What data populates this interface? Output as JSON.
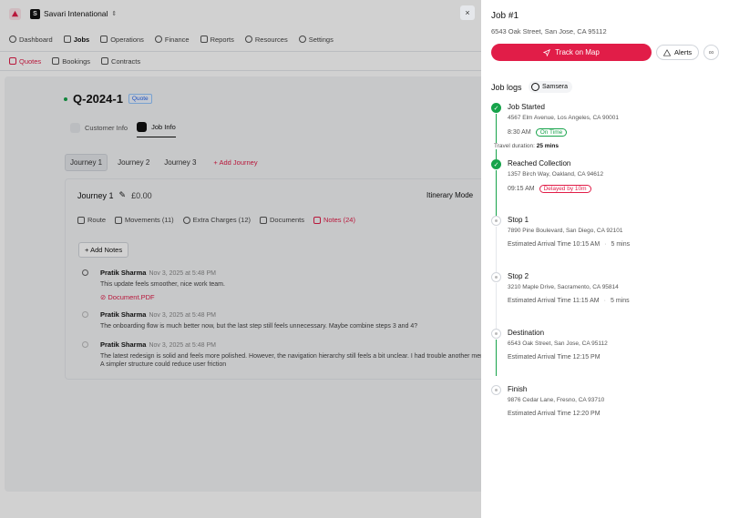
{
  "topbar": {
    "org_initial": "S",
    "org_name": "Savari Intenational"
  },
  "mainnav": [
    {
      "label": "Dashboard",
      "active": false
    },
    {
      "label": "Jobs",
      "active": true
    },
    {
      "label": "Operations",
      "active": false
    },
    {
      "label": "Finance",
      "active": false
    },
    {
      "label": "Reports",
      "active": false
    },
    {
      "label": "Resources",
      "active": false
    },
    {
      "label": "Settings",
      "active": false
    }
  ],
  "subnav": [
    {
      "label": "Quotes",
      "active": true
    },
    {
      "label": "Bookings",
      "active": false
    },
    {
      "label": "Contracts",
      "active": false
    }
  ],
  "quote": {
    "id": "Q-2024-1",
    "badge": "Quote"
  },
  "info_tabs": [
    {
      "label": "Customer Info"
    },
    {
      "label": "Job Info"
    }
  ],
  "journeys": {
    "tabs": [
      "Journey 1",
      "Journey 2",
      "Journey 3"
    ],
    "add_label": "Add Journey"
  },
  "card": {
    "title": "Journey 1",
    "amount": "£0.00",
    "itinerary_label": "Itinerary Mode",
    "tabs": [
      "Route",
      "Movements (11)",
      "Extra Charges (12)",
      "Documents",
      "Notes (24)"
    ],
    "add_notes_label": "Add Notes"
  },
  "notes": [
    {
      "author": "Pratik Sharma",
      "time": "Nov 3, 2025 at 5:48 PM",
      "text": "This update feels smoother, nice work team.",
      "attachment": "Document.PDF"
    },
    {
      "author": "Pratik Sharma",
      "time": "Nov 3, 2025 at 5:48 PM",
      "text": "The onboarding flow is much better now, but the last step still feels unnecessary. Maybe combine steps 3 and 4?"
    },
    {
      "author": "Pratik Sharma",
      "time": "Nov 3, 2025 at 5:48 PM",
      "text": "The latest redesign is solid and feels more polished. However, the navigation hierarchy still feels a bit unclear. I had trouble another menu. A simpler structure could reduce user friction"
    }
  ],
  "panel": {
    "close_glyph": "×",
    "job_title": "Job #1",
    "job_address": "6543 Oak Street, San Jose, CA 95112",
    "track_label": "Track on Map",
    "alerts_label": "Alerts",
    "logs_title": "Job logs",
    "provider": "Samsera",
    "travel_label": "Travel duration:",
    "travel_value": "25 mins"
  },
  "stops": [
    {
      "name": "Job Started",
      "address": "4567 Elm Avenue, Los Angeles, CA 90001",
      "time": "8:30 AM",
      "status": "On Time",
      "state": "done"
    },
    {
      "name": "Reached Collection",
      "address": "1357 Birch Way, Oakland, CA 94612",
      "time": "09:15 AM",
      "status": "Delayed by 10m",
      "state": "done"
    },
    {
      "name": "Stop 1",
      "address": "7890 Pine Boulevard, San Diego, CA 92101",
      "eta": "Estimated Arrival Time 10:15 AM",
      "duration": "5 mins",
      "state": "pending"
    },
    {
      "name": "Stop 2",
      "address": "3210 Maple Drive, Sacramento, CA 95814",
      "eta": "Estimated Arrival Time 11:15 AM",
      "duration": "5 mins",
      "state": "pending"
    },
    {
      "name": "Destination",
      "address": "6543 Oak Street, San Jose, CA 95112",
      "eta": "Estimated Arrival Time 12:15 PM",
      "state": "pending"
    },
    {
      "name": "Finish",
      "address": "9876 Cedar Lane, Fresno, CA 93710",
      "eta": "Estimated Arrival Time 12:20 PM",
      "state": "pending"
    }
  ],
  "colors": {
    "accent": "#e11d48",
    "success": "#16a34a"
  }
}
